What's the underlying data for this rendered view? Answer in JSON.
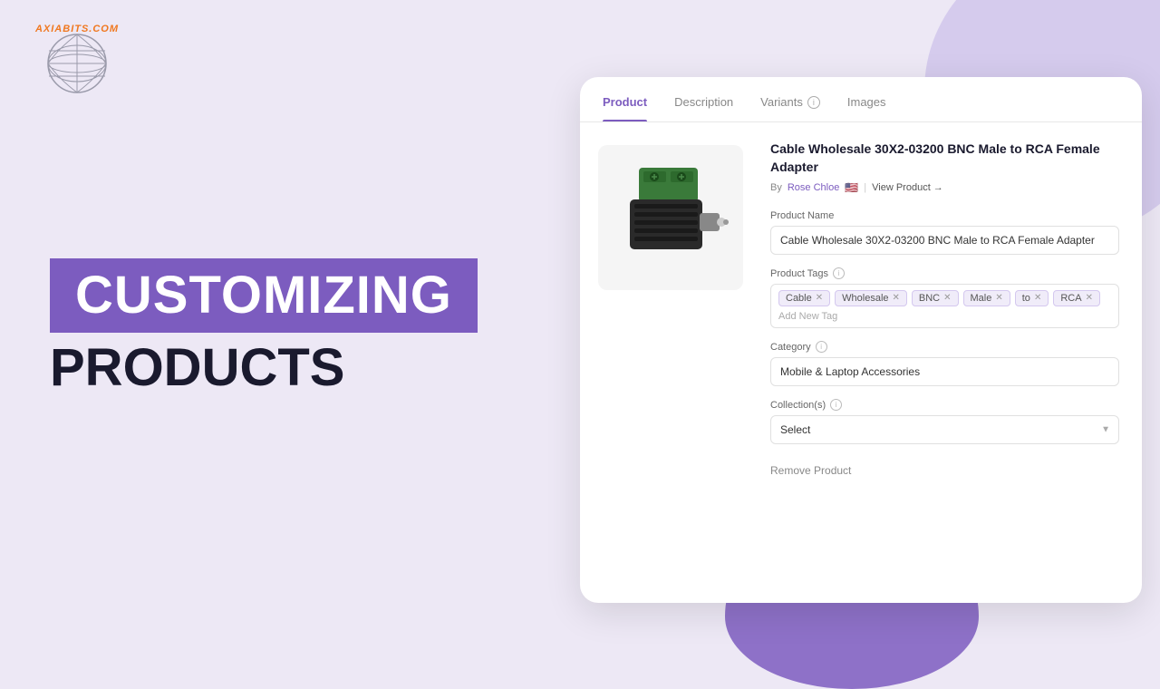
{
  "brand": {
    "name": "AXIABITS.COM",
    "tagline": "AXIABITS.COM"
  },
  "hero": {
    "line1": "CUSTOMIZING",
    "line2": "PRODUCTS"
  },
  "tabs": [
    {
      "id": "product",
      "label": "Product",
      "active": true,
      "hasInfo": false
    },
    {
      "id": "description",
      "label": "Description",
      "active": false,
      "hasInfo": false
    },
    {
      "id": "variants",
      "label": "Variants",
      "active": false,
      "hasInfo": true
    },
    {
      "id": "images",
      "label": "Images",
      "active": false,
      "hasInfo": false
    }
  ],
  "product": {
    "title": "Cable Wholesale 30X2-03200 BNC Male to RCA Female Adapter",
    "author": "Rose Chloe",
    "flag": "🇺🇸",
    "viewProductLabel": "View Product →",
    "productNameLabel": "Product Name",
    "productNameValue": "Cable Wholesale 30X2-03200 BNC Male to RCA Female Adapter",
    "productTagsLabel": "Product Tags",
    "tags": [
      "Cable",
      "Wholesale",
      "BNC",
      "Male",
      "to",
      "RCA"
    ],
    "addTagLabel": "Add New Tag",
    "categoryLabel": "Category",
    "categoryValue": "Mobile & Laptop Accessories",
    "collectionsLabel": "Collection(s)",
    "collectionsPlaceholder": "Select",
    "removeProductLabel": "Remove Product"
  },
  "colors": {
    "brand_purple": "#7c5cbf",
    "accent_orange": "#f07820",
    "bg_light": "#ede8f5",
    "text_dark": "#1a1a2e"
  }
}
